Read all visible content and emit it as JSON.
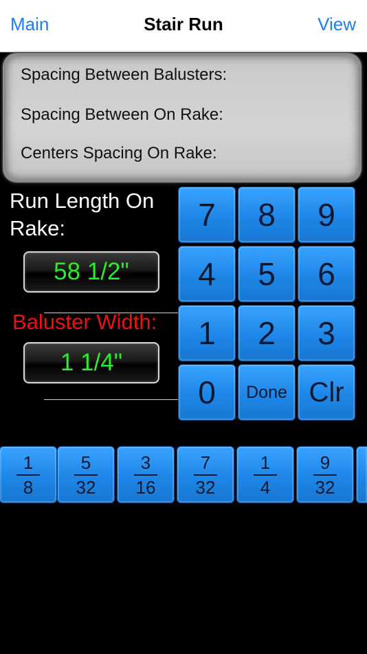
{
  "nav": {
    "left_label": "Main",
    "title": "Stair Run",
    "right_label": "View"
  },
  "results": {
    "line1": "Spacing Between Balusters:",
    "line2": "Spacing Between On Rake:",
    "line3": "Centers Spacing On Rake:"
  },
  "inputs": {
    "run_label": "Run Length On Rake:",
    "run_value": "58 1/2\"",
    "width_label": "Baluster Width:",
    "width_value": "1 1/4\""
  },
  "keypad": {
    "k7": "7",
    "k8": "8",
    "k9": "9",
    "k4": "4",
    "k5": "5",
    "k6": "6",
    "k1": "1",
    "k2": "2",
    "k3": "3",
    "k0": "0",
    "done": "Done",
    "clr": "Clr"
  },
  "fractions": [
    {
      "num": "1",
      "den": "8"
    },
    {
      "num": "5",
      "den": "32"
    },
    {
      "num": "3",
      "den": "16"
    },
    {
      "num": "7",
      "den": "32"
    },
    {
      "num": "1",
      "den": "4"
    },
    {
      "num": "9",
      "den": "32"
    }
  ],
  "colors": {
    "accent": "#1a7ef0",
    "key_blue": "#1e86e6",
    "lcd_text": "#29ee29",
    "warning_label": "#ee1111"
  }
}
